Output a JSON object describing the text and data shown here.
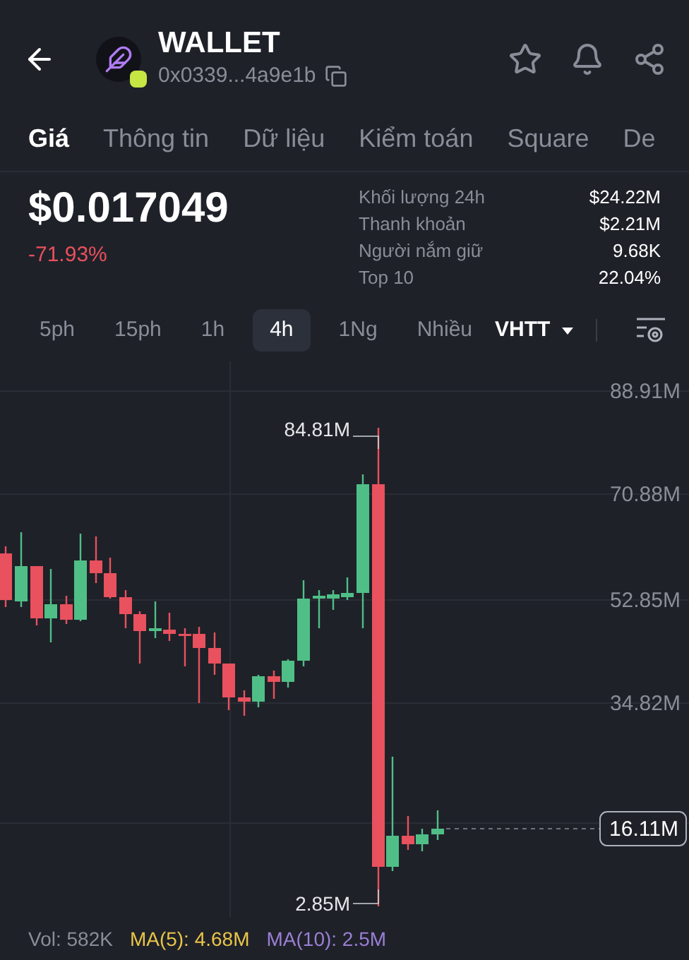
{
  "header": {
    "title": "WALLET",
    "address": "0x0339...4a9e1b"
  },
  "tabs": [
    {
      "label": "Giá",
      "selected": true
    },
    {
      "label": "Thông tin",
      "selected": false
    },
    {
      "label": "Dữ liệu",
      "selected": false
    },
    {
      "label": "Kiểm toán",
      "selected": false
    },
    {
      "label": "Square",
      "selected": false
    },
    {
      "label": "De",
      "selected": false
    }
  ],
  "price": {
    "value": "$0.017049",
    "change": "-71.93%"
  },
  "stats": [
    {
      "label": "Khối lượng 24h",
      "value": "$24.22M"
    },
    {
      "label": "Thanh khoản",
      "value": "$2.21M"
    },
    {
      "label": "Người nắm giữ",
      "value": "9.68K"
    },
    {
      "label": "Top 10",
      "value": "22.04%"
    }
  ],
  "timeframes": [
    {
      "label": "5ph",
      "selected": false
    },
    {
      "label": "15ph",
      "selected": false
    },
    {
      "label": "1h",
      "selected": false
    },
    {
      "label": "4h",
      "selected": true
    },
    {
      "label": "1Ng",
      "selected": false
    },
    {
      "label": "Nhiều",
      "selected": false
    }
  ],
  "chart_type": "VHTT",
  "chart": {
    "y_labels": [
      "88.91M",
      "70.88M",
      "52.85M",
      "34.82M"
    ],
    "high_label": "84.81M",
    "low_label": "2.85M",
    "current_price": "16.11M"
  },
  "volume": {
    "vol": "Vol: 582K",
    "ma5": "MA(5): 4.68M",
    "ma10": "MA(10): 2.5M"
  }
}
